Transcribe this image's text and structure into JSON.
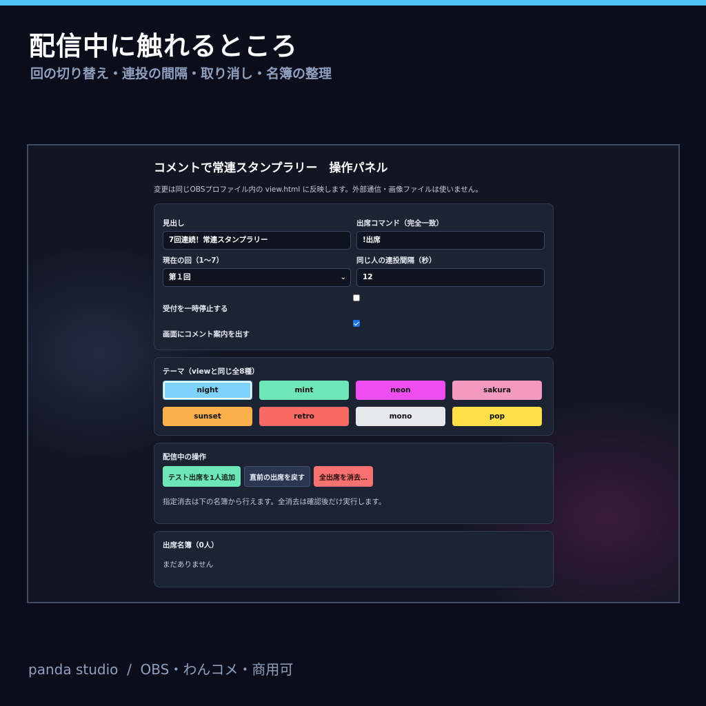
{
  "hero": {
    "title": "配信中に触れるところ",
    "subtitle": "回の切り替え・連投の間隔・取り消し・名簿の整理"
  },
  "panel": {
    "title": "コメントで常連スタンプラリー　操作パネル",
    "note": "変更は同じOBSプロファイル内の view.html に反映します。外部通信・画像ファイルは使いません。"
  },
  "settings": {
    "heading_label": "見出し",
    "heading_value": "7回連続！常連スタンプラリー",
    "command_label": "出席コマンド（完全一致）",
    "command_value": "!出席",
    "round_label": "現在の回（1〜7）",
    "round_value": "第１回",
    "interval_label": "同じ人の連投間隔（秒）",
    "interval_value": "12",
    "pause_label": "受付を一時停止する",
    "pause_checked": false,
    "guide_label": "画面にコメント案内を出す",
    "guide_checked": true
  },
  "themes": {
    "label": "テーマ（viewと同じ全8種）",
    "selected": "night",
    "items": [
      {
        "name": "night",
        "color": "#7dd3fc"
      },
      {
        "name": "mint",
        "color": "#6ee7b7"
      },
      {
        "name": "neon",
        "color": "#f04df0"
      },
      {
        "name": "sakura",
        "color": "#f49ac1"
      },
      {
        "name": "sunset",
        "color": "#fbb04c"
      },
      {
        "name": "retro",
        "color": "#f96a63"
      },
      {
        "name": "mono",
        "color": "#e5e7eb"
      },
      {
        "name": "pop",
        "color": "#fde047"
      }
    ]
  },
  "ops": {
    "label": "配信中の操作",
    "add_test": "テスト出席を1人追加",
    "undo_last": "直前の出席を戻す",
    "clear_all": "全出席を消去…",
    "note": "指定消去は下の名簿から行えます。全消去は確認後だけ実行します。"
  },
  "roster": {
    "label": "出席名簿（0人）",
    "empty": "まだありません"
  },
  "footer": {
    "text": "panda studio  /  OBS・わんコメ・商用可"
  }
}
